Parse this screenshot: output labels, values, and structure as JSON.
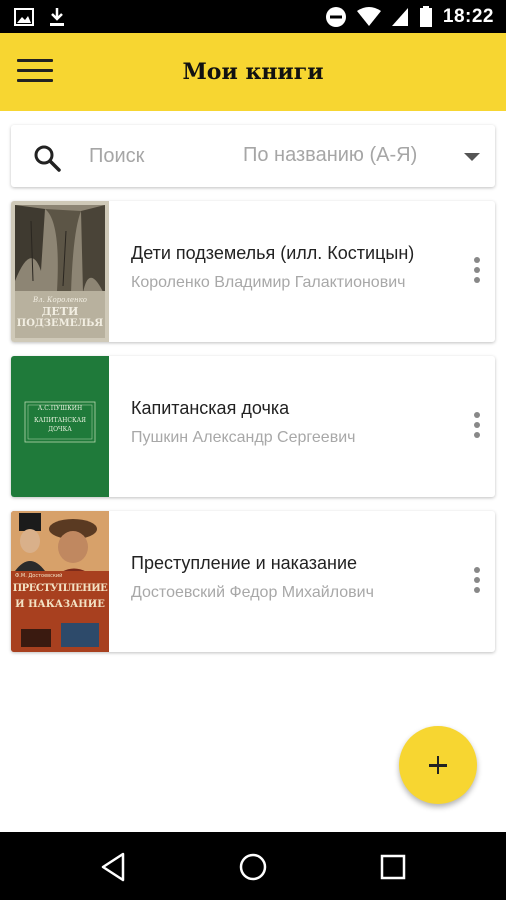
{
  "status_bar": {
    "time": "18:22",
    "left_icons": [
      "image-icon",
      "download-icon"
    ],
    "right_icons": [
      "do-not-disturb-icon",
      "wifi-icon",
      "signal-icon",
      "battery-icon"
    ]
  },
  "app_bar": {
    "title": "Мои книги",
    "menu_icon": "menu-icon"
  },
  "search": {
    "placeholder": "Поиск",
    "sort_selected": "По названию (А-Я)"
  },
  "books": [
    {
      "title": "Дети подземелья (илл. Костицын)",
      "author": "Короленко Владимир Галактионович",
      "cover_text": [
        "Вл. Короленко",
        "ДЕТИ",
        "ПОДЗЕМЕЛЬЯ"
      ]
    },
    {
      "title": "Капитанская дочка",
      "author": "Пушкин Александр Сергеевич",
      "cover_text": [
        "А.С.ПУШКИН",
        "КАПИТАНСКАЯ",
        "ДОЧКА"
      ]
    },
    {
      "title": "Преступление и наказание",
      "author": "Достоевский Федор Михайлович",
      "cover_text": [
        "Ф.М. Достоевский",
        "ПРЕСТУПЛЕНИЕ",
        "И НАКАЗАНИЕ"
      ]
    }
  ],
  "colors": {
    "accent": "#f7d631",
    "title_text": "#222222",
    "secondary_text": "#a8a8a8",
    "cover_green": "#1f7a3a"
  },
  "fab": {
    "icon": "plus-icon"
  },
  "nav_bar": {
    "icons": [
      "back-icon",
      "home-icon",
      "recents-icon"
    ]
  }
}
